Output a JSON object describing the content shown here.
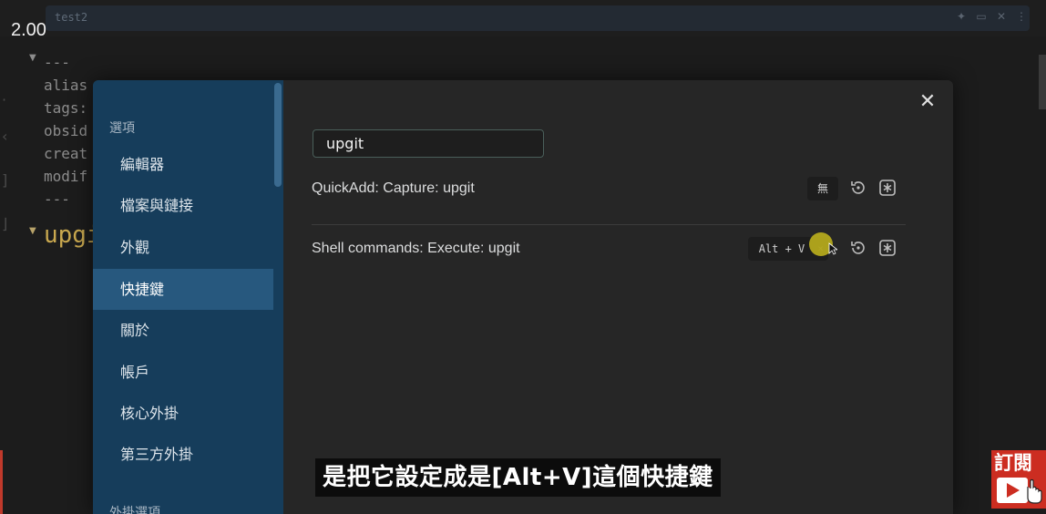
{
  "video": {
    "speed": "2.00"
  },
  "background_editor": {
    "tab_title": "test2",
    "tab_actions": [
      "pin-icon",
      "reading-icon",
      "close-icon",
      "more-icon"
    ],
    "code_lines": [
      "---",
      "alias",
      "tags:",
      "obsid",
      "creat",
      "modif",
      "---"
    ],
    "heading": "upgi"
  },
  "settings": {
    "sidebar": {
      "section_options": "選項",
      "items": [
        {
          "label": "編輯器",
          "active": false
        },
        {
          "label": "檔案與鏈接",
          "active": false
        },
        {
          "label": "外觀",
          "active": false
        },
        {
          "label": "快捷鍵",
          "active": true
        },
        {
          "label": "關於",
          "active": false
        },
        {
          "label": "帳戶",
          "active": false
        },
        {
          "label": "核心外掛",
          "active": false
        },
        {
          "label": "第三方外掛",
          "active": false
        }
      ],
      "section_plugin_options": "外掛選項"
    },
    "close_icon": "close-icon",
    "search": {
      "value": "upgit",
      "placeholder": ""
    },
    "hotkeys": [
      {
        "command": "QuickAdd: Capture: upgit",
        "key": "無",
        "removable": false
      },
      {
        "command": "Shell commands: Execute: upgit",
        "key": "Alt + V",
        "remove_glyph": "×",
        "removable": true
      }
    ],
    "row_icons": [
      "restore-default-icon",
      "add-hotkey-icon"
    ]
  },
  "subtitle": "是把它設定成是[Alt+V]這個快捷鍵",
  "subscribe": {
    "label": "訂閱"
  },
  "colors": {
    "sidebar_bg": "#163d5b",
    "sidebar_active": "#27587e",
    "modal_bg": "#262626",
    "cursor_highlight": "#b9ad1c",
    "subscribe_red": "#cc2d21"
  }
}
